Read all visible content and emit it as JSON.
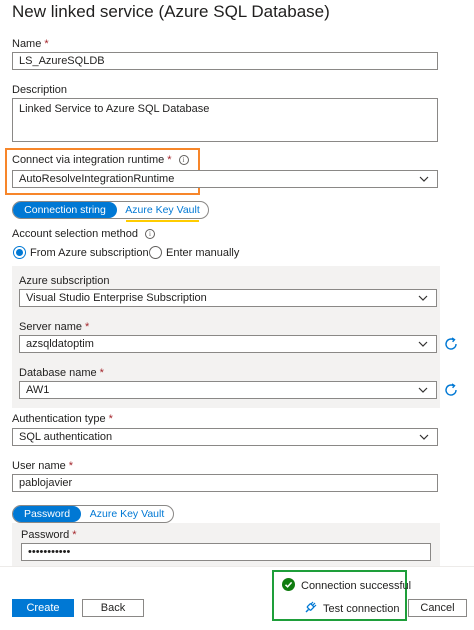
{
  "page": {
    "title": "New linked service (Azure SQL Database)"
  },
  "name": {
    "label": "Name",
    "value": "LS_AzureSQLDB"
  },
  "description": {
    "label": "Description",
    "value": "Linked Service to Azure SQL Database"
  },
  "runtime": {
    "label": "Connect via integration runtime",
    "value": "AutoResolveIntegrationRuntime"
  },
  "connection_toggle": {
    "options": [
      "Connection string",
      "Azure Key Vault"
    ],
    "selected": "Connection string"
  },
  "account_method": {
    "label": "Account selection method",
    "options": [
      "From Azure subscription",
      "Enter manually"
    ],
    "selected": "From Azure subscription"
  },
  "subscription": {
    "label": "Azure subscription",
    "value": "Visual Studio Enterprise Subscription"
  },
  "server": {
    "label": "Server name",
    "value": "azsqldatoptim"
  },
  "database": {
    "label": "Database name",
    "value": "AW1"
  },
  "auth": {
    "label": "Authentication type",
    "value": "SQL authentication"
  },
  "username": {
    "label": "User name",
    "value": "pablojavier"
  },
  "password_toggle": {
    "options": [
      "Password",
      "Azure Key Vault"
    ],
    "selected": "Password"
  },
  "password": {
    "label": "Password",
    "value": "•••••••••••"
  },
  "status": {
    "text": "Connection successful",
    "color": "#107c10"
  },
  "footer": {
    "create": "Create",
    "back": "Back",
    "test": "Test connection",
    "cancel": "Cancel"
  },
  "highlight_colors": {
    "runtime_box": "#f7862a",
    "keyvault_underline": "#ffcc00",
    "status_box": "#1e9e3a"
  },
  "icons": {
    "info": "info-icon",
    "chevron": "chevron-down-icon",
    "refresh": "refresh-icon",
    "check": "check-circle-icon",
    "plug": "plug-icon"
  }
}
